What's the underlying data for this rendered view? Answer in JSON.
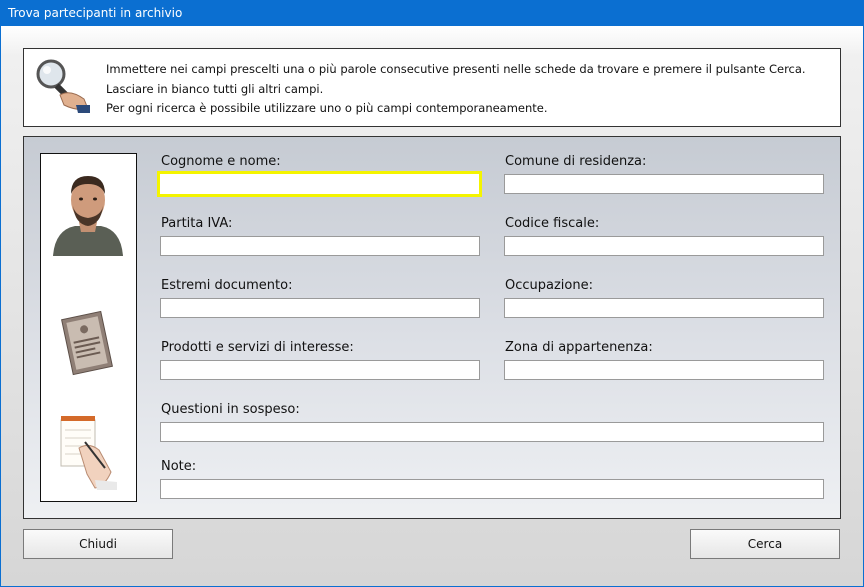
{
  "window": {
    "title": "Trova partecipanti in archivio"
  },
  "info": {
    "lines": [
      "Immettere nei campi prescelti una o più parole consecutive presenti nelle schede da trovare e premere il pulsante Cerca.",
      "Lasciare in bianco tutti gli altri campi.",
      "Per ogni ricerca è possibile utilizzare uno o più campi contemporaneamente."
    ]
  },
  "fields": {
    "cognome_nome": {
      "label": "Cognome e nome:",
      "value": ""
    },
    "comune": {
      "label": "Comune di residenza:",
      "value": ""
    },
    "partita_iva": {
      "label": "Partita IVA:",
      "value": ""
    },
    "codice_fiscale": {
      "label": "Codice fiscale:",
      "value": ""
    },
    "estremi_documento": {
      "label": "Estremi documento:",
      "value": ""
    },
    "occupazione": {
      "label": "Occupazione:",
      "value": ""
    },
    "prodotti_servizi": {
      "label": "Prodotti e servizi di interesse:",
      "value": ""
    },
    "zona": {
      "label": "Zona di appartenenza:",
      "value": ""
    },
    "questioni": {
      "label": "Questioni in sospeso:",
      "value": ""
    },
    "note": {
      "label": "Note:",
      "value": ""
    }
  },
  "buttons": {
    "close": "Chiudi",
    "search": "Cerca"
  },
  "colors": {
    "titlebar": "#0b6fd1",
    "focus_border": "#f4f400"
  },
  "icons": {
    "info": "magnifier-icon",
    "person": "person-photo",
    "document": "document-icon",
    "notepad": "notepad-writing-icon"
  }
}
